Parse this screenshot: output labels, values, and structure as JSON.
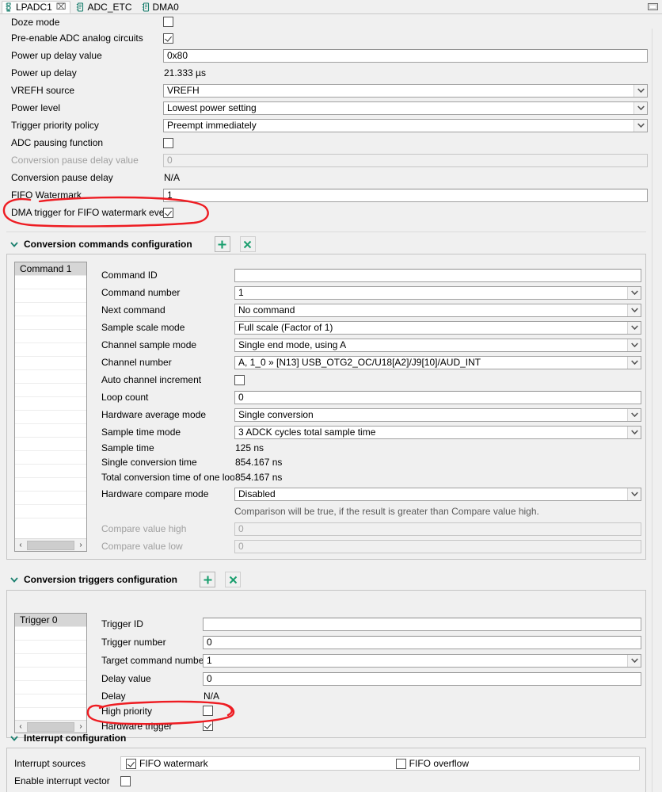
{
  "window": {
    "minimize_label": "minimize"
  },
  "tabs": [
    {
      "label": "LPADC1",
      "icon": "chip-icon",
      "active": true,
      "closable": true,
      "close_glyph": "⌧"
    },
    {
      "label": "ADC_ETC",
      "icon": "chip-icon",
      "active": false,
      "closable": false
    },
    {
      "label": "DMA0",
      "icon": "chip-icon",
      "active": false,
      "closable": false
    }
  ],
  "general_rows": [
    {
      "label": "Doze mode",
      "type": "checkbox",
      "checked": false
    },
    {
      "label": "Pre-enable ADC analog circuits",
      "type": "checkbox",
      "checked": true
    },
    {
      "label": "Power up delay value",
      "type": "text",
      "value": "0x80"
    },
    {
      "label": "Power up delay",
      "type": "static",
      "value": "21.333 µs"
    },
    {
      "label": "VREFH source",
      "type": "combo",
      "value": "VREFH"
    },
    {
      "label": "Power level",
      "type": "combo",
      "value": "Lowest power setting"
    },
    {
      "label": "Trigger priority policy",
      "type": "combo",
      "value": "Preempt immediately"
    },
    {
      "label": "ADC pausing function",
      "type": "checkbox",
      "checked": false
    },
    {
      "label": "Conversion pause delay value",
      "type": "text",
      "value": "0",
      "disabled": true
    },
    {
      "label": "Conversion pause delay",
      "type": "static",
      "value": "N/A"
    },
    {
      "label": "FIFO Watermark",
      "type": "text",
      "value": "1"
    },
    {
      "label": "DMA trigger for FIFO watermark event",
      "type": "checkbox",
      "checked": true,
      "annotated": true
    }
  ],
  "commands_section": {
    "title": "Conversion commands configuration",
    "add_label": "+",
    "remove_label": "×",
    "list": {
      "items": [
        "Command 1"
      ],
      "selected_index": 0,
      "empty_rows": 19
    },
    "rows": [
      {
        "label": "Command ID",
        "type": "text",
        "value": ""
      },
      {
        "label": "Command number",
        "type": "combo",
        "value": "1"
      },
      {
        "label": "Next command",
        "type": "combo",
        "value": "No command"
      },
      {
        "label": "Sample scale mode",
        "type": "combo",
        "value": "Full scale (Factor of 1)"
      },
      {
        "label": "Channel sample mode",
        "type": "combo",
        "value": "Single end mode, using A"
      },
      {
        "label": "Channel number",
        "type": "combo",
        "value": "A, 1_0 » [N13] USB_OTG2_OC/U18[A2]/J9[10]/AUD_INT"
      },
      {
        "label": "Auto channel increment",
        "type": "checkbox",
        "checked": false
      },
      {
        "label": "Loop count",
        "type": "text",
        "value": "0"
      },
      {
        "label": "Hardware average mode",
        "type": "combo",
        "value": "Single conversion"
      },
      {
        "label": "Sample time mode",
        "type": "combo",
        "value": "3 ADCK cycles total sample time"
      },
      {
        "label": "Sample time",
        "type": "static",
        "value": "125 ns"
      },
      {
        "label": "Single conversion time",
        "type": "static",
        "value": "854.167 ns"
      },
      {
        "label": "Total conversion time of one loop",
        "type": "static",
        "value": "854.167 ns"
      },
      {
        "label": "Hardware compare mode",
        "type": "combo",
        "value": "Disabled"
      },
      {
        "label": "",
        "type": "hint",
        "value": "Comparison will be true, if the result is greater than Compare value high."
      },
      {
        "label": "Compare value high",
        "type": "text",
        "value": "0",
        "disabled": true
      },
      {
        "label": "Compare value low",
        "type": "text",
        "value": "0",
        "disabled": true
      }
    ]
  },
  "triggers_section": {
    "title": "Conversion triggers configuration",
    "add_label": "+",
    "remove_label": "×",
    "list": {
      "items": [
        "Trigger 0"
      ],
      "selected_index": 0,
      "empty_rows": 6
    },
    "rows": [
      {
        "label": "Trigger ID",
        "type": "text",
        "value": ""
      },
      {
        "label": "Trigger number",
        "type": "text",
        "value": "0"
      },
      {
        "label": "Target command number",
        "type": "combo",
        "value": "1"
      },
      {
        "label": "Delay value",
        "type": "text",
        "value": "0"
      },
      {
        "label": "Delay",
        "type": "static",
        "value": "N/A"
      },
      {
        "label": "High priority",
        "type": "checkbox",
        "checked": false
      },
      {
        "label": "Hardware trigger",
        "type": "checkbox",
        "checked": true,
        "annotated": true
      }
    ]
  },
  "interrupt_section": {
    "title": "Interrupt configuration",
    "sources_label": "Interrupt sources",
    "sources": [
      {
        "label": "FIFO watermark",
        "checked": true
      },
      {
        "label": "FIFO overflow",
        "checked": false
      }
    ],
    "enable_vector": {
      "label": "Enable interrupt vector",
      "checked": false
    }
  },
  "annotations": {
    "color": "#ee1c22",
    "marks": [
      {
        "name": "dma-trigger-circle"
      },
      {
        "name": "hardware-trigger-circle"
      }
    ]
  },
  "colors": {
    "accent": "#1a7f6e",
    "background": "#f0f0f0",
    "field": "#ffffff",
    "disabled_text": "#a0a0a0",
    "annotation": "#ee1c22"
  }
}
